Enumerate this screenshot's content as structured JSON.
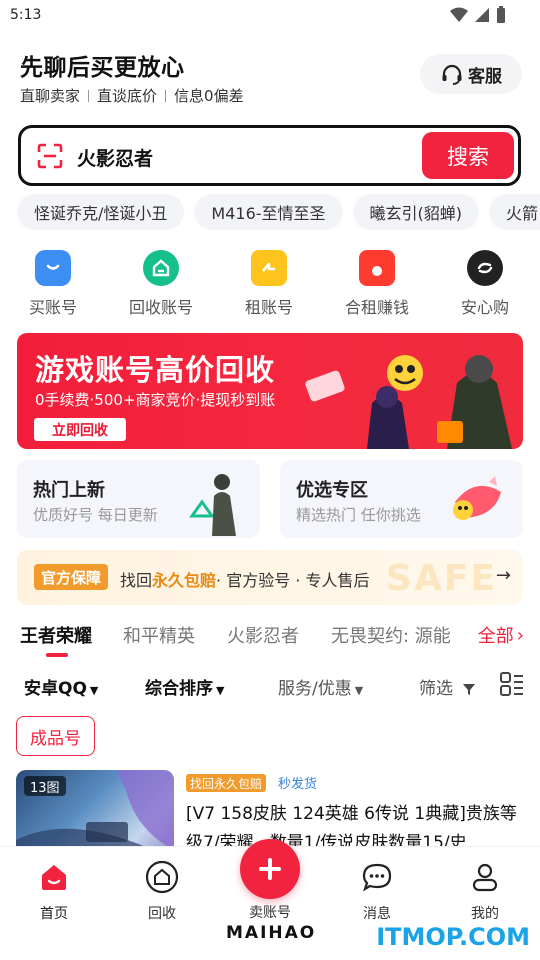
{
  "status": {
    "time": "5:13"
  },
  "header": {
    "slogan": "先聊后买更放心",
    "features": [
      "直聊卖家",
      "直谈底价",
      "信息0偏差"
    ],
    "service_label": "客服"
  },
  "search": {
    "query": "火影忍者",
    "button_label": "搜索"
  },
  "hot_tags": [
    "怪诞乔克/怪诞小丑",
    "M416-至情至圣",
    "曦玄引(貂蝉)",
    "火箭"
  ],
  "nav": [
    {
      "label": "买账号",
      "color": "#3d8ef3"
    },
    {
      "label": "回收账号",
      "color": "#16c08c"
    },
    {
      "label": "租账号",
      "color": "#ffc31d"
    },
    {
      "label": "合租赚钱",
      "color": "#ff3b30"
    },
    {
      "label": "安心购",
      "color": "#222222"
    }
  ],
  "banner": {
    "title": "游戏账号高价回收",
    "subtitle": "0手续费·500+商家竞价·提现秒到账",
    "cta": "立即回收"
  },
  "feature_cards": [
    {
      "title": "热门上新",
      "subtitle": "优质好号 每日更新"
    },
    {
      "title": "优选专区",
      "subtitle": "精选热门 任你挑选"
    }
  ],
  "guarantee": {
    "badge": "官方保障",
    "text_prefix": "找回",
    "highlight": "永久包赔",
    "text_suffix": "· 官方验号 · 专人售后",
    "bg_word": "SAFE"
  },
  "game_tabs": [
    "王者荣耀",
    "和平精英",
    "火影忍者",
    "无畏契约: 源能"
  ],
  "all_label": "全部",
  "filters": [
    "安卓QQ",
    "综合排序",
    "服务/优惠",
    "筛选"
  ],
  "chip_label": "成品号",
  "product": {
    "image_count": "13图",
    "tag": "找回永久包赔",
    "tag2": "秒发货",
    "title": "[V7 158皮肤 124英雄 6传说 1典藏]贵族等级7/荣耀...数量1/传说皮肤数量15/史"
  },
  "tabbar": [
    {
      "label": "首页"
    },
    {
      "label": "回收"
    },
    {
      "label": "卖账号"
    },
    {
      "label": "消息"
    },
    {
      "label": "我的"
    }
  ],
  "brand": "MAIHAO",
  "watermark": "ITMOP.COM",
  "colors": {
    "accent": "#f2233f",
    "orange": "#f19b2c"
  }
}
